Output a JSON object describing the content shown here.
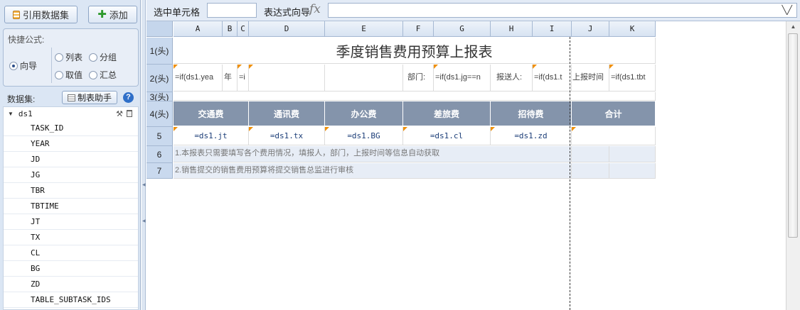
{
  "left_panel": {
    "ref_dataset_label": "引用数据集",
    "add_label": "添加",
    "quick_formula": {
      "title": "快捷公式:",
      "options": [
        "向导",
        "列表",
        "分组",
        "取值",
        "汇总"
      ],
      "selected": "向导"
    },
    "dataset_label": "数据集:",
    "helper_label": "制表助手",
    "dataset_name": "ds1",
    "fields": [
      "TASK_ID",
      "YEAR",
      "JD",
      "JG",
      "TBR",
      "TBTIME",
      "JT",
      "TX",
      "CL",
      "BG",
      "ZD",
      "TABLE_SUBTASK_IDS"
    ]
  },
  "formula_bar": {
    "cell_label": "选中单元格",
    "cell_value": "",
    "expr_label": "表达式向导",
    "fx": "fx",
    "expr_value": ""
  },
  "sheet": {
    "columns": [
      "A",
      "B",
      "C",
      "D",
      "E",
      "F",
      "G",
      "H",
      "I",
      "J",
      "K"
    ],
    "rows": [
      "1(头)",
      "2(头)",
      "3(头)",
      "4(头)",
      "5",
      "6",
      "7"
    ],
    "title": "季度销售费用预算上报表",
    "row2": {
      "a": "=if(ds1.yea",
      "b": "年",
      "c": "=i",
      "f": "部门:",
      "g": "=if(ds1.jg==n",
      "h": "报送人:",
      "i": "=if(ds1.t",
      "j": "上报时间",
      "k": "=if(ds1.tbt"
    },
    "headers": [
      "交通费",
      "通讯费",
      "办公费",
      "差旅费",
      "招待费",
      "合计"
    ],
    "formulas": [
      "=ds1.jt",
      "=ds1.tx",
      "=ds1.BG",
      "=ds1.cl",
      "=ds1.zd"
    ],
    "notes": [
      "1.本报表只需要填写各个费用情况，填报人，部门，上报时间等信息自动获取",
      "2.销售提交的销售费用预算将提交销售总监进行审核"
    ]
  },
  "colors": {
    "header_fill": "#8494ab",
    "note_fill": "#e7edf6",
    "panel_bg": "#dbe6f4",
    "formula_text": "#1c3e78"
  }
}
